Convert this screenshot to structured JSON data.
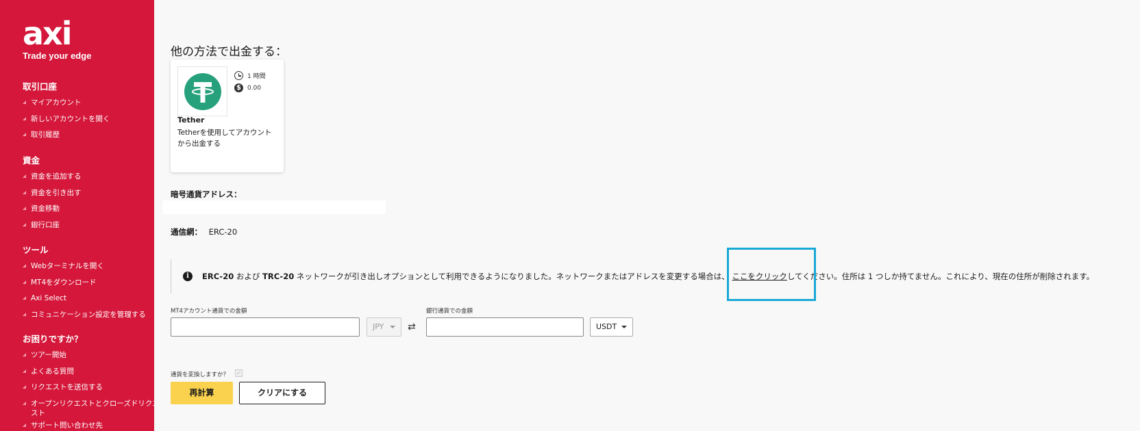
{
  "brand": {
    "logo": "axi",
    "tagline": "Trade your edge"
  },
  "sidebar": {
    "sections": [
      {
        "heading": "取引口座",
        "items": [
          "マイアカウント",
          "新しいアカウントを開く",
          "取引履歴"
        ]
      },
      {
        "heading": "資金",
        "items": [
          "資金を追加する",
          "資金を引き出す",
          "資金移動",
          "銀行口座"
        ]
      },
      {
        "heading": "ツール",
        "items": [
          "Webターミナルを開く",
          "MT4をダウンロード",
          "Axi Select",
          "コミュニケーション設定を管理する"
        ]
      },
      {
        "heading": "お困りですか？",
        "items": [
          "ツアー開始",
          "よくある質問",
          "リクエストを送信する",
          "オープンリクエストとクローズドリクエスト",
          "サポート問い合わせ先"
        ]
      }
    ]
  },
  "main": {
    "title": "他の方法で出金する：",
    "method_card": {
      "duration": "1 時間",
      "fee": "0.00",
      "name": "Tether",
      "description": "Tetherを使用してアカウントから出金する"
    },
    "address_label": "暗号通貨アドレス：",
    "network_label": "通信網：",
    "network_value": "ERC-20",
    "notice": {
      "erc": "ERC-20",
      "and": " および ",
      "trc": "TRC-20",
      "text_before_link": " ネットワークが引き出しオプションとして利用できるようになりました。ネットワークまたはアドレスを変更する場合は、 ",
      "link": "ここをクリック",
      "text_after_link": "してください。住所は 1 つしか持てません。これにより、現在の住所が削除されます。"
    },
    "mt4_amount_label": "MT4アカウント通貨での金額",
    "mt4_amount_value": "",
    "mt4_currency": "JPY",
    "bank_amount_label": "銀行通貨での金額",
    "bank_amount_value": "",
    "bank_currency": "USDT",
    "convert_label": "通貨を変換しますか？",
    "recalc_button": "再計算",
    "clear_button": "クリアにする"
  },
  "colors": {
    "sidebar_bg": "#d4173a",
    "tether_green": "#26a17b",
    "primary_button": "#fbd24e",
    "highlight": "#17a8d6"
  }
}
